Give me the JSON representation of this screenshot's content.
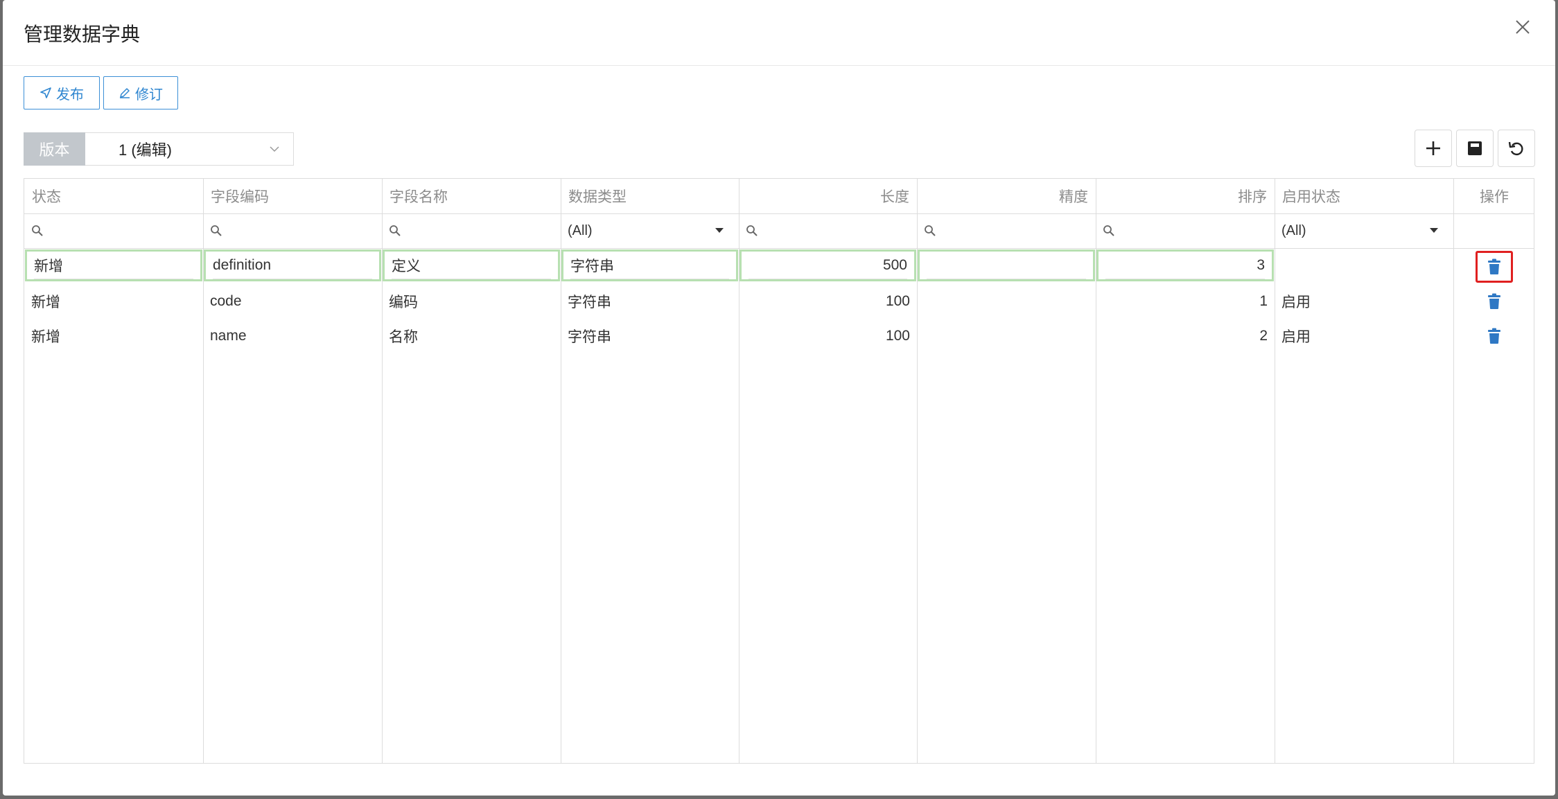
{
  "dialog": {
    "title": "管理数据字典"
  },
  "toolbar": {
    "publish_label": "发布",
    "revise_label": "修订"
  },
  "version": {
    "label": "版本",
    "selected": "1 (编辑)"
  },
  "grid": {
    "columns": [
      {
        "key": "status",
        "label": "状态"
      },
      {
        "key": "field_code",
        "label": "字段编码"
      },
      {
        "key": "field_name",
        "label": "字段名称"
      },
      {
        "key": "data_type",
        "label": "数据类型"
      },
      {
        "key": "length",
        "label": "长度"
      },
      {
        "key": "precision",
        "label": "精度"
      },
      {
        "key": "sort",
        "label": "排序"
      },
      {
        "key": "enabled",
        "label": "启用状态"
      },
      {
        "key": "action",
        "label": "操作"
      }
    ],
    "filters": {
      "data_type": "(All)",
      "enabled": "(All)"
    },
    "rows": [
      {
        "status": "新增",
        "field_code": "definition",
        "field_name": "定义",
        "data_type": "字符串",
        "length": "500",
        "precision": "",
        "sort": "3",
        "enabled": ""
      },
      {
        "status": "新增",
        "field_code": "code",
        "field_name": "编码",
        "data_type": "字符串",
        "length": "100",
        "precision": "",
        "sort": "1",
        "enabled": "启用"
      },
      {
        "status": "新增",
        "field_code": "name",
        "field_name": "名称",
        "data_type": "字符串",
        "length": "100",
        "precision": "",
        "sort": "2",
        "enabled": "启用"
      }
    ]
  },
  "colors": {
    "accent": "#2f86d0",
    "trash": "#2f78c4",
    "edit_border": "#b7e0b1",
    "highlight": "#e02020"
  },
  "icons": [
    "close-icon",
    "send-icon",
    "edit-pen-icon",
    "chevron-down-icon",
    "plus-icon",
    "save-icon",
    "undo-icon",
    "search-icon",
    "trash-icon"
  ]
}
